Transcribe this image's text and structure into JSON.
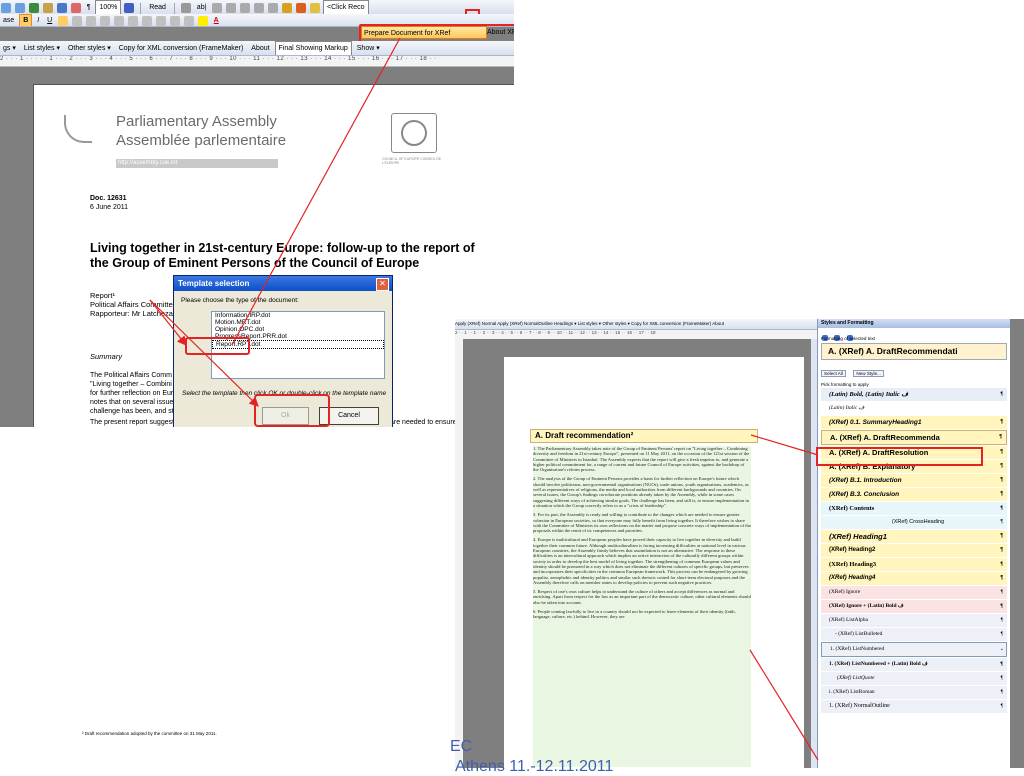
{
  "win1": {
    "toolbar1": {
      "zoom": "100%",
      "read": "Read",
      "click_text": "<Click Reco"
    },
    "toolbar2": {
      "style_box": "ase",
      "prep_label": "Prepare Document for XRef",
      "about_label": "About XRef"
    },
    "toolbar3": {
      "items": [
        "gs ▾",
        "List styles ▾",
        "Other styles ▾",
        "Copy for XML conversion (FrameMaker)",
        "About",
        "Final Showing Markup",
        "Show ▾"
      ]
    },
    "ruler": "2 · · · 1 · · · · · 1 · · · 2 · · · 3 · · · 4 · · · 5 · · · 6 · · · 7 · · · 8 · · · 9 · · · 10 · · · 11 · · · 12 · · · 13 · · · 14 · · · 15 · · · 16 · · · 17 · · · 18 · ·",
    "doc": {
      "org_en": "Parliamentary Assembly",
      "org_fr": "Assemblée parlementaire",
      "url": "http://assembly.coe.int",
      "coe_label": "COUNCIL OF EUROPE   CONSEIL DE L'EUROPE",
      "doc_no": "Doc. 12631",
      "date": "6 June 2011",
      "title": "Living together in 21st-century Europe: follow-up to the report of the Group of Eminent Persons of the Council of Europe",
      "report_line": "Report¹",
      "committee_line": "Political Affairs Committee",
      "rapporteur_line": "Rapporteur: Mr Latchezar",
      "summary_head": "Summary",
      "summary_lines": [
        "The Political Affairs Comm",
        "\"Living together – Combini",
        "for further reflection on Eur",
        "notes that on several issue",
        "challenge has been, and st"
      ],
      "summary_right": [
        "inent Persons on",
        "posals as a basis",
        "reform process. It",
        "e Assembly. The"
      ],
      "para2": "The present report suggests that the Parliamentary Assembly ... contribute to the changes which are needed to ensure greater cohesion in European societies, so that everyone may fully benefit from living together. It therefore proposes that, inter alia, the Assembly reflect on ways to overcome"
    },
    "dialog": {
      "title": "Template selection",
      "close": "✕",
      "prompt": "Please choose the type of the document:",
      "templates": [
        "Information.IRP.dot",
        "Motion.MRT.dot",
        "Opinion.OPC.dot",
        "ProgressReport.PRR.dot",
        "Report.RPT.dot"
      ],
      "hint": "Select the template then click OK or double-click on the template name",
      "ok": "Ok",
      "cancel": "Cancel"
    }
  },
  "win2": {
    "toolbar": "Apply (XRef) Normal   Apply (XRef) NormalOutline   Headings ▾  List styles ▾  Other styles ▾   Copy for XML conversion (FrameMaker)   About",
    "ruler": "2 · · 1 · · 1 · · 2 · · 3 · · 4 · · 5 · · 6 · · 7 · · 8 · · 9 · · 10 · · 11 · · 12 · · 13 · · 14 · · 15 · · 16 · · 17 · · 18",
    "heading": "A. Draft recommendation²",
    "paras": [
      "1.     The Parliamentary Assembly takes note of the Group of Eminent Persons' report on \"Living together – Combining diversity and freedom in 21st-century Europe\", presented on 11 May 2011, on the occasion of the 121st session of the Committee of Ministers in Istanbul. The Assembly expects that the report will give a fresh impetus to, and generate a higher political commitment for, a range of current and future Council of Europe activities, against the backdrop of the Organisation's reform process.",
      "2.     The analysis of the Group of Eminent Persons provides a basis for further reflection on Europe's future which should involve politicians, non-governmental organisations (NGOs), trade unions, youth organisations, academics, as well as representatives of religions, the media and local authorities from different backgrounds and countries. On several issues, the Group's findings corroborate positions already taken by the Assembly, while in some cases suggesting different ways of achieving similar goals. The challenge has been, and still is, to ensure implementation in a situation which the Group correctly refers to as a \"crisis of leadership\".",
      "3.     For its part, the Assembly is ready and willing to contribute to the changes which are needed to ensure greater cohesion in European societies, so that everyone may fully benefit from living together. It therefore wishes to share with the Committee of Ministers its own reflections on the matter and propose concrete ways of implementation of the proposals within the remit of its competences and priorities.",
      "4.     Europe is multicultural and European peoples have proved their capacity to live together in diversity and build together their common future. Although multiculturalism is facing increasing difficulties at national level in various European countries, the Assembly firmly believes that assimilation is not an alternative. The response to these difficulties is an intercultural approach which implies an active interaction of the culturally different groups within society in order to develop the best model of living together. The strengthening of common European values and identity should be promoted in a way which does not eliminate the different cultures of specific groups, but preserves and incorporates their specificities in the common European framework. This process can be endangered by growing populist, xenophobic and identity politics and similar such rhetoric coined for short-term electoral purposes and the Assembly therefore calls on member states to develop policies to prevent such negative practices.",
      "5.     Respect of one's own culture helps to understand the culture of others and accept differences as normal and enriching. Apart from respect for the law as an important part of the democratic culture, other cultural elements should also be taken into account.",
      "6.     People coming lawfully to live in a country should not be expected to leave elements of their identity (faith, language, culture, etc.) behind. However, they are"
    ],
    "footnote": "² Draft recommendation adopted by the committee on 31 May 2011."
  },
  "pane": {
    "title": "Styles and Formatting",
    "formatting_label": "Formatting of selected text",
    "current": "A.  (XRef) A. DraftRecommendati",
    "select_all": "Select All",
    "new_style": "New Style...",
    "pick_label": "Pick formatting to apply",
    "styles": [
      "(Latin) Bold, (Latin) Italic ف",
      "(Latin) Italic ف",
      "(XRef) 0.1. SummaryHeading1",
      "A.  (XRef) A. DraftRecommenda",
      "A.  (XRef) A. DraftResolution",
      "A.  (XRef) B. Explanatory",
      "(XRef) B.1. Introduction",
      "(XRef) B.3. Conclusion",
      "(XRef) Contents",
      "(XRef) CrossHeading",
      "(XRef) Heading1",
      "(XRef) Heading2",
      "(XRef) Heading3",
      "(XRef) Heading4",
      "(XRef) Ignore",
      "(XRef) Ignore + (Latin) Bold ف",
      "(XRef) ListAlpha",
      "-  (XRef) ListBulleted",
      "1.  (XRef) ListNumbered",
      "1.  (XRef) ListNumbered + (Latin) Bold ف",
      "(XRef) ListQuote",
      "i.  (XRef) ListRoman",
      "1.  (XRef) NormalOutline"
    ],
    "pmark": "¶"
  },
  "overlay": {
    "line1": "EC",
    "line2": "Athens 11.-12.11.2011"
  },
  "colors": {
    "highlight": "#e32424",
    "accent": "#ffc659",
    "doc_green": "#e9f7e2",
    "doc_yellow": "#fff5bd"
  }
}
